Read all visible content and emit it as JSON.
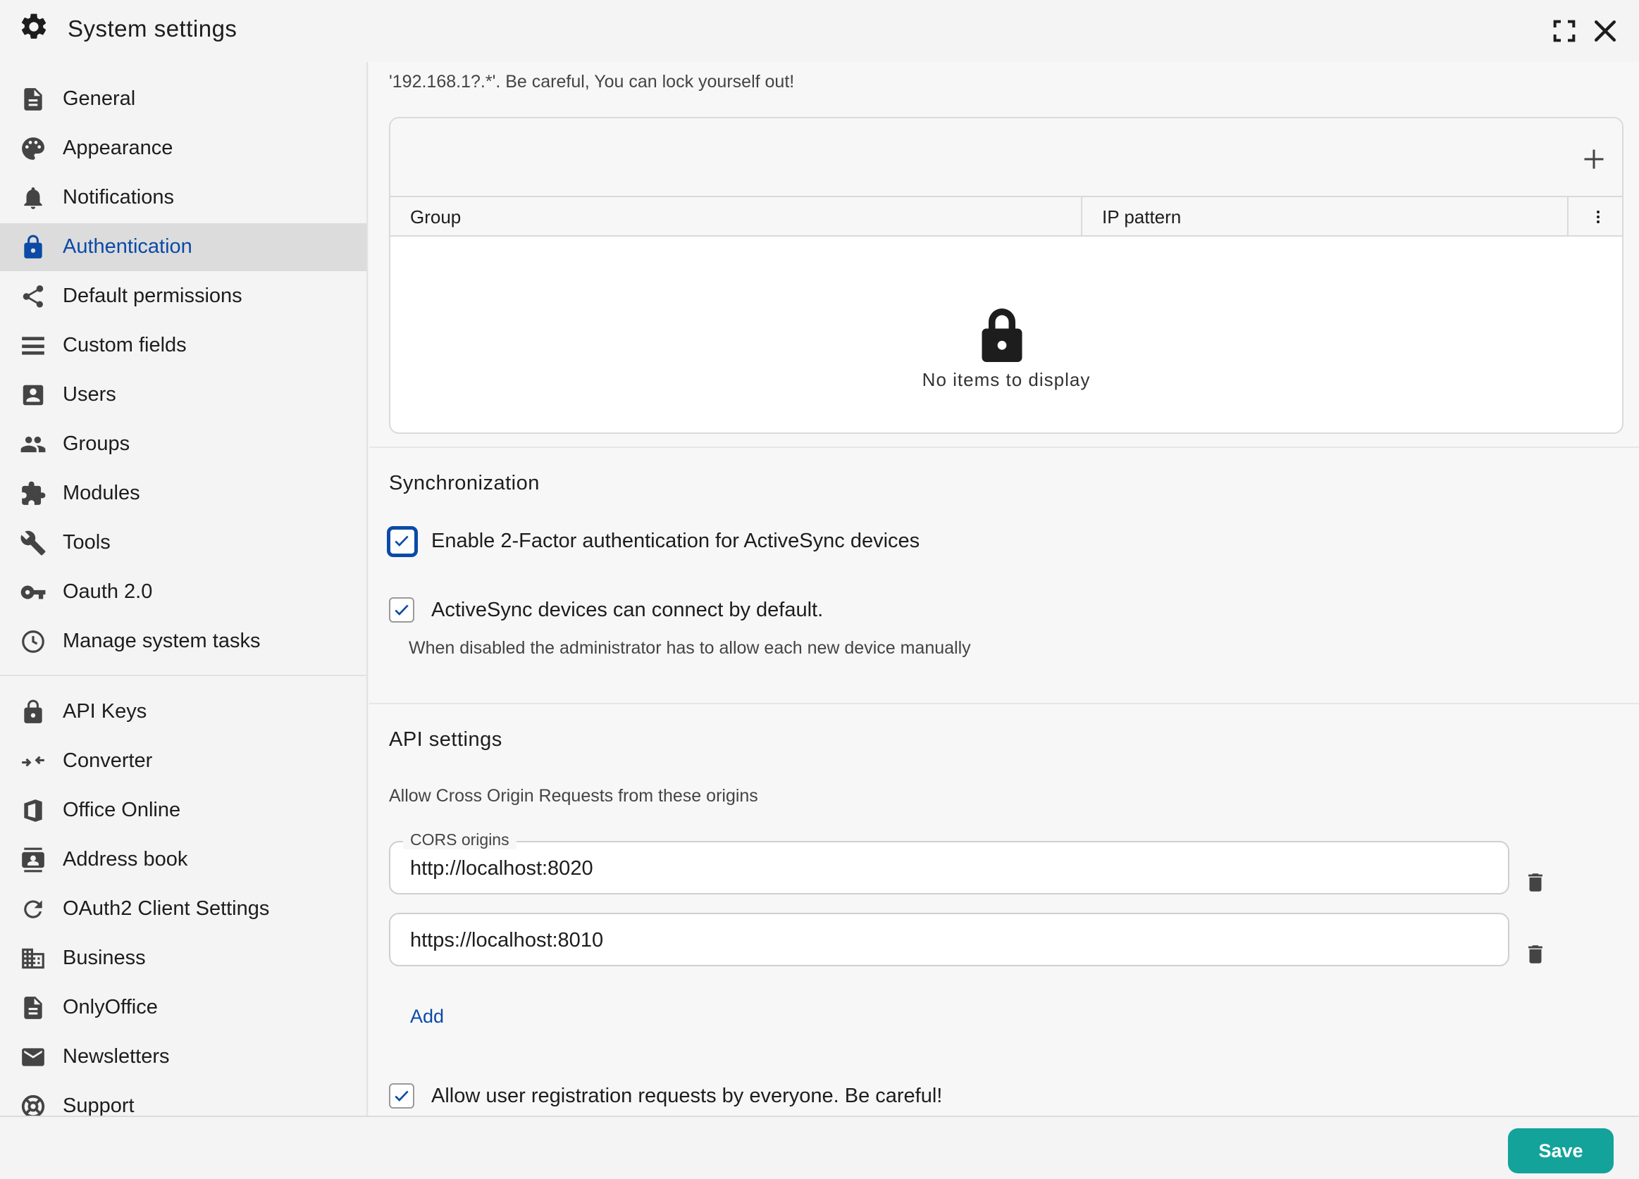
{
  "window": {
    "title": "System settings",
    "icons": {
      "app": "gear-icon",
      "maximize": "maximize-icon",
      "close": "close-icon"
    }
  },
  "sidebar": {
    "items": [
      {
        "label": "General",
        "icon": "document-icon"
      },
      {
        "label": "Appearance",
        "icon": "palette-icon"
      },
      {
        "label": "Notifications",
        "icon": "bell-icon"
      },
      {
        "label": "Authentication",
        "icon": "lock-icon",
        "active": true
      },
      {
        "label": "Default permissions",
        "icon": "share-icon"
      },
      {
        "label": "Custom fields",
        "icon": "list-icon"
      },
      {
        "label": "Users",
        "icon": "user-icon"
      },
      {
        "label": "Groups",
        "icon": "group-icon"
      },
      {
        "label": "Modules",
        "icon": "puzzle-icon"
      },
      {
        "label": "Tools",
        "icon": "wrench-icon"
      },
      {
        "label": "Oauth 2.0",
        "icon": "key-icon"
      },
      {
        "label": "Manage system tasks",
        "icon": "clock-icon"
      }
    ],
    "items2": [
      {
        "label": "API Keys",
        "icon": "lock-icon"
      },
      {
        "label": "Converter",
        "icon": "converter-icon"
      },
      {
        "label": "Office Online",
        "icon": "office-icon"
      },
      {
        "label": "Address book",
        "icon": "contact-icon"
      },
      {
        "label": "OAuth2 Client Settings",
        "icon": "refresh-icon"
      },
      {
        "label": "Business",
        "icon": "building-icon"
      },
      {
        "label": "OnlyOffice",
        "icon": "document-icon"
      },
      {
        "label": "Newsletters",
        "icon": "mail-icon"
      },
      {
        "label": "Support",
        "icon": "lifebuoy-icon"
      }
    ]
  },
  "main": {
    "warning_text": "'192.168.1?.*'. Be careful, You can lock yourself out!",
    "ip_table": {
      "columns": [
        "Group",
        "IP pattern"
      ],
      "empty_text": "No items to display",
      "rows": []
    },
    "sync": {
      "heading": "Synchronization",
      "twofa_label": "Enable 2-Factor authentication for ActiveSync devices",
      "twofa_checked": true,
      "connect_label": "ActiveSync devices can connect by default.",
      "connect_checked": true,
      "connect_hint": "When disabled the administrator has to allow each new device manually"
    },
    "api": {
      "heading": "API settings",
      "cors_desc": "Allow Cross Origin Requests from these origins",
      "cors_legend": "CORS origins",
      "origins": [
        "http://localhost:8020",
        "https://localhost:8010"
      ],
      "add_label": "Add",
      "registration_label": "Allow user registration requests by everyone. Be careful!",
      "registration_checked": true
    }
  },
  "footer": {
    "save_label": "Save"
  },
  "colors": {
    "accent": "#0b4aa6",
    "save": "#13a39a",
    "active_bg": "#dcdcdc"
  }
}
